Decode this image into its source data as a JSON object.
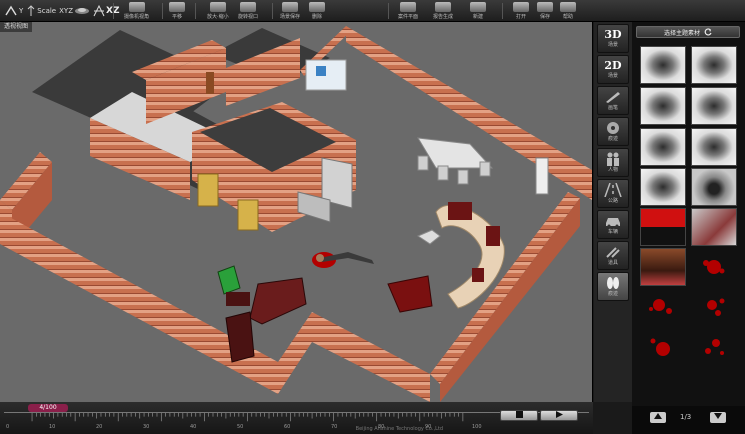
{
  "toolbar": {
    "axis_y": "Y",
    "axis_scale": "Scale",
    "axis_xyz": "XYZ",
    "axis_xz": "XZ",
    "buttons": [
      {
        "icon": "camera-icon",
        "label": "摄像机视角"
      },
      {
        "icon": "hand-icon",
        "label": "平移"
      },
      {
        "icon": "zoom-icon",
        "label": "放大·缩小"
      },
      {
        "icon": "rotate-icon",
        "label": "旋转视口"
      },
      {
        "icon": "save-icon",
        "label": "场景保存"
      },
      {
        "icon": "delete-icon",
        "label": "删除"
      },
      {
        "icon": "plan-icon",
        "label": "案件平面"
      },
      {
        "icon": "generate-icon",
        "label": "报告生成"
      },
      {
        "icon": "new-icon",
        "label": "新建"
      },
      {
        "icon": "open-icon",
        "label": "打开"
      },
      {
        "icon": "store-icon",
        "label": "保存"
      },
      {
        "icon": "help-icon",
        "label": "帮助"
      }
    ]
  },
  "viewport": {
    "title": "透视视图",
    "floor_color": "#6a6a6a"
  },
  "timeline": {
    "frame_display": "4/100",
    "ticks": [
      "0",
      "10",
      "20",
      "30",
      "40",
      "50",
      "60",
      "70",
      "80",
      "90",
      "100"
    ],
    "copyright": "Beijing Anshine Technology Co.,Ltd"
  },
  "sidetools": [
    {
      "big": "3D",
      "small": "场景",
      "icon": ""
    },
    {
      "big": "2D",
      "small": "场景",
      "icon": ""
    },
    {
      "big": "",
      "small": "画笔",
      "icon": "pen-icon"
    },
    {
      "big": "",
      "small": "痕迹",
      "icon": "reel-icon"
    },
    {
      "big": "",
      "small": "人物",
      "icon": "people-icon"
    },
    {
      "big": "",
      "small": "公路",
      "icon": "road-icon"
    },
    {
      "big": "",
      "small": "车辆",
      "icon": "car-icon"
    },
    {
      "big": "",
      "small": "道具",
      "icon": "tools-icon"
    },
    {
      "big": "",
      "small": "痕迹",
      "icon": "footprint-icon"
    }
  ],
  "panel": {
    "header": "选择主题素材",
    "refresh_icon": "refresh-icon",
    "page_label": "1/3",
    "up_icon": "triangle-up-icon",
    "down_icon": "triangle-down-icon",
    "thumbnails": [
      "fingerprint",
      "fingerprint",
      "fingerprint",
      "fingerprint",
      "fingerprint",
      "fingerprint",
      "fingerprint",
      "fingerprint",
      "fingerprint",
      "eye-photo",
      "blood-splash",
      "blood-photo",
      "room-photo",
      "blood-drop",
      "blood-drop",
      "blood-drop",
      "blood-drop",
      "blood-drop"
    ]
  },
  "colors": {
    "brick": "#c46a4c",
    "blood": "#b30000",
    "sofa": "#e8d2b6",
    "chair_red": "#7a1010"
  }
}
